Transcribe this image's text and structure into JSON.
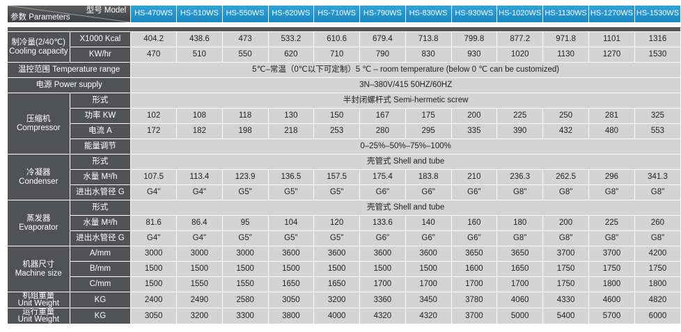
{
  "header": {
    "model_label": "型号 Model",
    "param_label": "参数 Parameters",
    "models": [
      "HS-470WS",
      "HS-510WS",
      "HS-550WS",
      "HS-620WS",
      "HS-710WS",
      "HS-790WS",
      "HS-830WS",
      "HS-930WS",
      "HS-1020WS",
      "HS-1130WS",
      "HS-1270WS",
      "HS-1530WS"
    ]
  },
  "cooling": {
    "label": "制冷量(2/40℃)\nCooling capacity",
    "kcal_label": "X1000 Kcal",
    "kcal": [
      "404.2",
      "438.6",
      "473",
      "533.2",
      "610.6",
      "679.4",
      "713.8",
      "799.8",
      "877.2",
      "971.8",
      "1101",
      "1316"
    ],
    "kw_label": "KW/hr",
    "kw": [
      "470",
      "510",
      "550",
      "620",
      "710",
      "790",
      "830",
      "930",
      "1020",
      "1130",
      "1270",
      "1530"
    ]
  },
  "temperature": {
    "label": "温控范围 Temperature range",
    "value": "5℃–常温（0℃以下可定制）5 ℃ – room temperature (below 0 ℃ can be customized)"
  },
  "power": {
    "label": "电源 Power supply",
    "value": "3N–380V/415   50HZ/60HZ"
  },
  "compressor": {
    "label": "压缩机\nCompressor",
    "type_label": "形式",
    "type_value": "半封闭螺杆式 Semi-hermetic screw",
    "power_label": "功率 KW",
    "power": [
      "102",
      "108",
      "118",
      "130",
      "150",
      "167",
      "175",
      "200",
      "225",
      "250",
      "281",
      "325"
    ],
    "current_label": "电流 A",
    "current": [
      "172",
      "182",
      "198",
      "218",
      "253",
      "280",
      "295",
      "335",
      "390",
      "432",
      "480",
      "553"
    ],
    "capacity_label": "能量调节",
    "capacity_value": "0–25%–50%–75%–100%"
  },
  "condenser": {
    "label": "冷凝器\nCondenser",
    "type_label": "形式",
    "type_value": "壳管式 Shell and tube",
    "water_label": "水量 M³/h",
    "water": [
      "107.5",
      "113.4",
      "123.9",
      "136.5",
      "157.5",
      "175.4",
      "183.8",
      "210",
      "236.3",
      "262.5",
      "296",
      "341.3"
    ],
    "pipe_label": "进出水管径 G",
    "pipe": [
      "G4\"",
      "G4\"",
      "G5\"",
      "G5\"",
      "G5\"",
      "G6\"",
      "G6\"",
      "G6\"",
      "G8\"",
      "G8\"",
      "G8\"",
      "G8\""
    ]
  },
  "evaporator": {
    "label": "蒸发器\nEvaporator",
    "type_label": "形式",
    "type_value": "壳管式 Shell and tube",
    "water_label": "水量 M³/h",
    "water": [
      "81.6",
      "86.4",
      "95",
      "104",
      "120",
      "133.6",
      "140",
      "160",
      "180",
      "200",
      "225",
      "260"
    ],
    "pipe_label": "进出水管径 G",
    "pipe": [
      "G4\"",
      "G4\"",
      "G5\"",
      "G5\"",
      "G5\"",
      "G6\"",
      "G6\"",
      "G6\"",
      "G8\"",
      "G8\"",
      "G8\"",
      "G8\""
    ]
  },
  "size": {
    "label": "机器尺寸\nMachine size",
    "a_label": "A/mm",
    "a": [
      "3000",
      "3000",
      "3000",
      "3600",
      "3600",
      "3600",
      "3600",
      "3650",
      "3650",
      "3700",
      "3700",
      "4200"
    ],
    "b_label": "B/mm",
    "b": [
      "1500",
      "1500",
      "1500",
      "1500",
      "1500",
      "1500",
      "1500",
      "1600",
      "1650",
      "1750",
      "1750",
      "1750"
    ],
    "c_label": "C/mm",
    "c": [
      "1500",
      "1550",
      "1550",
      "1650",
      "1650",
      "1700",
      "1700",
      "1700",
      "1700",
      "1750",
      "1800",
      "1800"
    ]
  },
  "unit_weight": {
    "label": "机组重量\nUnit Weight",
    "kg_label": "KG",
    "values": [
      "2400",
      "2490",
      "2580",
      "3050",
      "3200",
      "3360",
      "3450",
      "3780",
      "4060",
      "4330",
      "4600",
      "4820"
    ]
  },
  "operating_weight": {
    "label": "运行重量\nUnit Weight",
    "kg_label": "KG",
    "values": [
      "3050",
      "3200",
      "3300",
      "3800",
      "4000",
      "4320",
      "4320",
      "3700",
      "5000",
      "5400",
      "5700",
      "6000"
    ]
  }
}
